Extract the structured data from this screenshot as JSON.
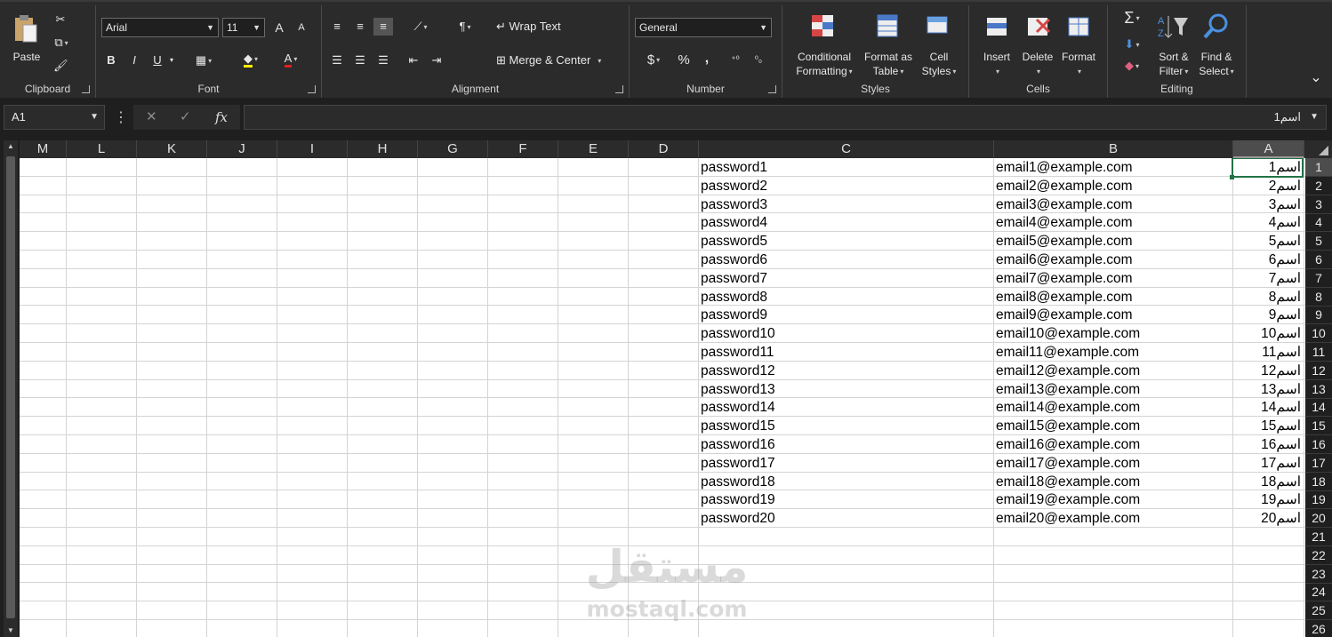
{
  "ribbon": {
    "clipboard": {
      "label": "Clipboard",
      "paste": "Paste"
    },
    "font": {
      "label": "Font",
      "family": "Arial",
      "size": "11",
      "bold": "B",
      "italic": "I",
      "underline": "U",
      "grow": "A",
      "shrink": "A",
      "font_color_letter": "A"
    },
    "alignment": {
      "label": "Alignment",
      "wrap_text": "Wrap Text",
      "merge_center": "Merge & Center"
    },
    "number": {
      "label": "Number",
      "format": "General",
      "currency": "$",
      "percent": "%",
      "comma": ","
    },
    "styles": {
      "label": "Styles",
      "conditional": [
        "Conditional",
        "Formatting"
      ],
      "format_table": [
        "Format as",
        "Table"
      ],
      "cell_styles": [
        "Cell",
        "Styles"
      ]
    },
    "cells": {
      "label": "Cells",
      "insert": "Insert",
      "delete": "Delete",
      "format": "Format"
    },
    "editing": {
      "label": "Editing",
      "sort": [
        "Sort &",
        "Filter"
      ],
      "find": [
        "Find &",
        "Select"
      ],
      "sum": "Σ"
    }
  },
  "formula_bar": {
    "name_box": "A1",
    "value": "اسم1",
    "cancel": "✕",
    "enter": "✓",
    "fx": "fx"
  },
  "columns": [
    "M",
    "L",
    "K",
    "J",
    "I",
    "H",
    "G",
    "F",
    "E",
    "D",
    "C",
    "B",
    "A"
  ],
  "selected_column": "A",
  "selected_cell": "A1",
  "rows": [
    {
      "n": "1",
      "a": "اسم1",
      "b": "email1@example.com",
      "c": "password1"
    },
    {
      "n": "2",
      "a": "اسم2",
      "b": "email2@example.com",
      "c": "password2"
    },
    {
      "n": "3",
      "a": "اسم3",
      "b": "email3@example.com",
      "c": "password3"
    },
    {
      "n": "4",
      "a": "اسم4",
      "b": "email4@example.com",
      "c": "password4"
    },
    {
      "n": "5",
      "a": "اسم5",
      "b": "email5@example.com",
      "c": "password5"
    },
    {
      "n": "6",
      "a": "اسم6",
      "b": "email6@example.com",
      "c": "password6"
    },
    {
      "n": "7",
      "a": "اسم7",
      "b": "email7@example.com",
      "c": "password7"
    },
    {
      "n": "8",
      "a": "اسم8",
      "b": "email8@example.com",
      "c": "password8"
    },
    {
      "n": "9",
      "a": "اسم9",
      "b": "email9@example.com",
      "c": "password9"
    },
    {
      "n": "10",
      "a": "اسم10",
      "b": "email10@example.com",
      "c": "password10"
    },
    {
      "n": "11",
      "a": "اسم11",
      "b": "email11@example.com",
      "c": "password11"
    },
    {
      "n": "12",
      "a": "اسم12",
      "b": "email12@example.com",
      "c": "password12"
    },
    {
      "n": "13",
      "a": "اسم13",
      "b": "email13@example.com",
      "c": "password13"
    },
    {
      "n": "14",
      "a": "اسم14",
      "b": "email14@example.com",
      "c": "password14"
    },
    {
      "n": "15",
      "a": "اسم15",
      "b": "email15@example.com",
      "c": "password15"
    },
    {
      "n": "16",
      "a": "اسم16",
      "b": "email16@example.com",
      "c": "password16"
    },
    {
      "n": "17",
      "a": "اسم17",
      "b": "email17@example.com",
      "c": "password17"
    },
    {
      "n": "18",
      "a": "اسم18",
      "b": "email18@example.com",
      "c": "password18"
    },
    {
      "n": "19",
      "a": "اسم19",
      "b": "email19@example.com",
      "c": "password19"
    },
    {
      "n": "20",
      "a": "اسم20",
      "b": "email20@example.com",
      "c": "password20"
    },
    {
      "n": "21",
      "a": "",
      "b": "",
      "c": ""
    },
    {
      "n": "22",
      "a": "",
      "b": "",
      "c": ""
    },
    {
      "n": "23",
      "a": "",
      "b": "",
      "c": ""
    },
    {
      "n": "24",
      "a": "",
      "b": "",
      "c": ""
    },
    {
      "n": "25",
      "a": "",
      "b": "",
      "c": ""
    },
    {
      "n": "26",
      "a": "",
      "b": "",
      "c": ""
    }
  ],
  "watermark": {
    "arabic": "مستقل",
    "latin": "mostaql.com"
  },
  "colors": {
    "accent": "#217346",
    "ribbon_bg": "#2b2b2b",
    "app_bg": "#1f1f1f",
    "grid_line": "#d4d4d4"
  }
}
